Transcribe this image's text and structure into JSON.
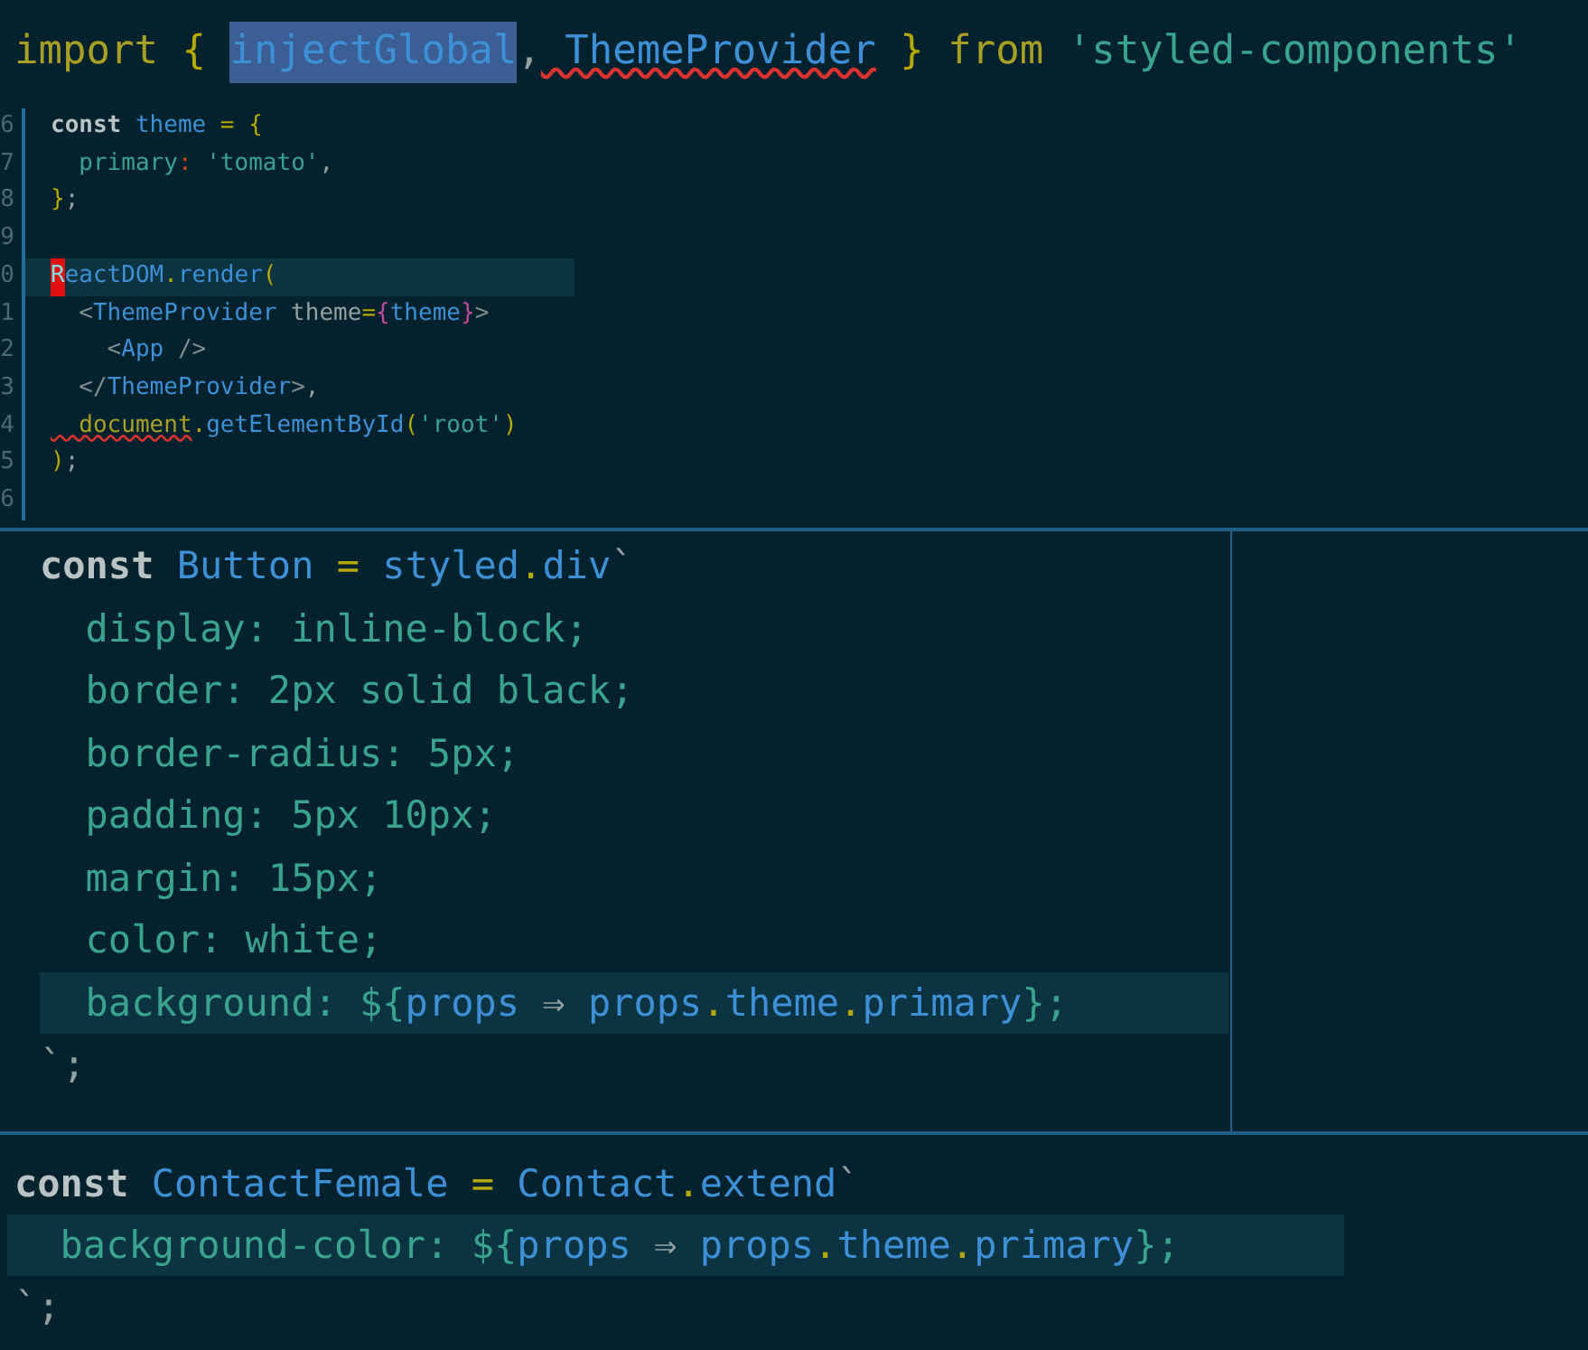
{
  "panels": [
    {
      "lines": [
        {
          "current": false,
          "tokens": [
            {
              "kind": "kw2",
              "text": "import"
            },
            {
              "kind": "punct",
              "text": " { "
            },
            {
              "kind": "sel",
              "text": "injectGlobal"
            },
            {
              "kind": "op",
              "text": ","
            },
            {
              "kind": "err",
              "text": " ThemeProvider"
            },
            {
              "kind": "punct",
              "text": " }"
            },
            {
              "kind": "kw2",
              "text": " from"
            },
            {
              "kind": "str",
              "text": " 'styled-components'"
            }
          ]
        }
      ]
    },
    {
      "lines": [
        {
          "number": "6",
          "current": false,
          "tokens": [
            {
              "kind": "kw",
              "text": "const"
            },
            {
              "kind": "id",
              "text": " theme"
            },
            {
              "kind": "punct",
              "text": " = {"
            }
          ]
        },
        {
          "number": "7",
          "current": false,
          "tokens": [
            {
              "kind": "prop",
              "text": "  primary"
            },
            {
              "kind": "colon",
              "text": ":"
            },
            {
              "kind": "str",
              "text": " 'tomato'"
            },
            {
              "kind": "op",
              "text": ","
            }
          ]
        },
        {
          "number": "8",
          "current": false,
          "tokens": [
            {
              "kind": "punct",
              "text": "}"
            },
            {
              "kind": "op",
              "text": ";"
            }
          ]
        },
        {
          "number": "9",
          "current": false
        },
        {
          "number": "0",
          "current": true,
          "tokens": [
            {
              "kind": "cursor",
              "text": "R"
            },
            {
              "kind": "id",
              "text": "eactDOM"
            },
            {
              "kind": "punct",
              "text": "."
            },
            {
              "kind": "id",
              "text": "render"
            },
            {
              "kind": "punct",
              "text": "("
            }
          ]
        },
        {
          "number": "1",
          "current": false,
          "tokens": [
            {
              "kind": "tag",
              "text": "  <"
            },
            {
              "kind": "id",
              "text": "ThemeProvider"
            },
            {
              "kind": "plain",
              "text": " theme"
            },
            {
              "kind": "punct",
              "text": "="
            },
            {
              "kind": "brace",
              "text": "{"
            },
            {
              "kind": "id",
              "text": "theme"
            },
            {
              "kind": "brace",
              "text": "}"
            },
            {
              "kind": "tag",
              "text": ">"
            }
          ]
        },
        {
          "number": "2",
          "current": false,
          "tokens": [
            {
              "kind": "tag",
              "text": "    <"
            },
            {
              "kind": "id",
              "text": "App"
            },
            {
              "kind": "tag",
              "text": " />"
            }
          ]
        },
        {
          "number": "3",
          "current": false,
          "tokens": [
            {
              "kind": "tag",
              "text": "  </"
            },
            {
              "kind": "id",
              "text": "ThemeProvider"
            },
            {
              "kind": "tag",
              "text": ">"
            },
            {
              "kind": "op",
              "text": ","
            }
          ]
        },
        {
          "number": "4",
          "current": false,
          "tokens": [
            {
              "kind": "err2",
              "text": "  document"
            },
            {
              "kind": "punct",
              "text": "."
            },
            {
              "kind": "id",
              "text": "getElementById"
            },
            {
              "kind": "punct",
              "text": "("
            },
            {
              "kind": "str",
              "text": "'root'"
            },
            {
              "kind": "punct",
              "text": ")"
            }
          ]
        },
        {
          "number": "5",
          "current": false,
          "tokens": [
            {
              "kind": "punct",
              "text": ")"
            },
            {
              "kind": "op",
              "text": ";"
            }
          ]
        },
        {
          "number": "6",
          "current": false
        }
      ]
    },
    {
      "lines": [
        {
          "current": false,
          "tokens": [
            {
              "kind": "kw",
              "text": "const"
            },
            {
              "kind": "id",
              "text": " Button"
            },
            {
              "kind": "punct",
              "text": " ="
            },
            {
              "kind": "id",
              "text": " styled"
            },
            {
              "kind": "punct",
              "text": "."
            },
            {
              "kind": "id",
              "text": "div"
            },
            {
              "kind": "op",
              "text": "`"
            }
          ]
        },
        {
          "current": false,
          "tokens": [
            {
              "kind": "prop",
              "text": "  display: inline-block;"
            }
          ]
        },
        {
          "current": false,
          "tokens": [
            {
              "kind": "prop",
              "text": "  border: 2px solid black;"
            }
          ]
        },
        {
          "current": false,
          "tokens": [
            {
              "kind": "prop",
              "text": "  border-radius: 5px;"
            }
          ]
        },
        {
          "current": false,
          "tokens": [
            {
              "kind": "prop",
              "text": "  padding: 5px 10px;"
            }
          ]
        },
        {
          "current": false,
          "tokens": [
            {
              "kind": "prop",
              "text": "  margin: 15px;"
            }
          ]
        },
        {
          "current": false,
          "tokens": [
            {
              "kind": "prop",
              "text": "  color: white;"
            }
          ]
        },
        {
          "current": true,
          "tokens": [
            {
              "kind": "prop",
              "text": "  background: ${"
            },
            {
              "kind": "id",
              "text": "props"
            },
            {
              "kind": "op",
              "text": " ⇒"
            },
            {
              "kind": "id",
              "text": " props"
            },
            {
              "kind": "punct",
              "text": "."
            },
            {
              "kind": "id",
              "text": "theme"
            },
            {
              "kind": "punct",
              "text": "."
            },
            {
              "kind": "id",
              "text": "primary"
            },
            {
              "kind": "prop",
              "text": "};"
            }
          ]
        },
        {
          "current": false,
          "tokens": [
            {
              "kind": "op",
              "text": "`;"
            }
          ]
        }
      ]
    },
    {
      "lines": [
        {
          "current": false,
          "tokens": [
            {
              "kind": "kw",
              "text": "const"
            },
            {
              "kind": "id",
              "text": " ContactFemale"
            },
            {
              "kind": "punct",
              "text": " ="
            },
            {
              "kind": "id",
              "text": " Contact"
            },
            {
              "kind": "punct",
              "text": "."
            },
            {
              "kind": "id",
              "text": "extend"
            },
            {
              "kind": "op",
              "text": "`"
            }
          ]
        },
        {
          "current": true,
          "tokens": [
            {
              "kind": "prop",
              "text": "  background-color: ${"
            },
            {
              "kind": "id",
              "text": "props"
            },
            {
              "kind": "op",
              "text": " ⇒"
            },
            {
              "kind": "id",
              "text": " props"
            },
            {
              "kind": "punct",
              "text": "."
            },
            {
              "kind": "id",
              "text": "theme"
            },
            {
              "kind": "punct",
              "text": "."
            },
            {
              "kind": "id",
              "text": "primary"
            },
            {
              "kind": "prop",
              "text": "};"
            }
          ]
        },
        {
          "current": false,
          "tokens": [
            {
              "kind": "op",
              "text": "`;"
            }
          ]
        }
      ]
    }
  ]
}
